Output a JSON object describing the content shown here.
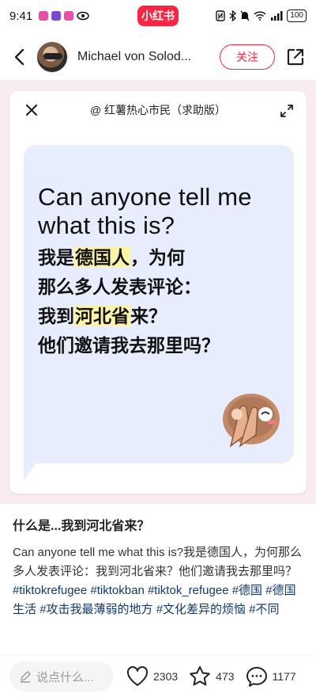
{
  "status_bar": {
    "time": "9:41",
    "app_pill": "小红书",
    "battery": "100",
    "notif_colors": [
      "#e94fa6",
      "#7b49d3",
      "#e94fa6"
    ]
  },
  "header": {
    "author_name": "Michael von Solod...",
    "follow_label": "关注"
  },
  "image_card": {
    "title": "@ 红薯热心市民（求助版）",
    "text_en": "Can anyone tell me what this is?",
    "text_zh_line1_a": "我是",
    "text_zh_line1_hl": "德国人",
    "text_zh_line1_b": "，为何",
    "text_zh_line2": "那么多人发表评论：",
    "text_zh_line3_a": "我到",
    "text_zh_line3_hl": "河北省",
    "text_zh_line3_b": "来？",
    "text_zh_line4": "他们邀请我去那里吗？",
    "emoji_icon": "face-with-hands-icon",
    "bubble_color": "#e7edfc",
    "highlight_color": "#fff3a8"
  },
  "post": {
    "title": "什么是...我到河北省来？",
    "body": "Can anyone tell me what this is?我是德国人，为何那么多人发表评论：我到河北省来？他们邀请我去那里吗？",
    "tags": [
      "#tiktokrefugee",
      "#tiktokban",
      "#tiktok_refugee",
      "#德国",
      "#德国生活",
      "#攻击我最薄弱的地方",
      "#文化差异的烦恼",
      "#不同"
    ]
  },
  "bottom_bar": {
    "comment_placeholder": "说点什么...",
    "likes": "2303",
    "collects": "473",
    "comments": "1177"
  },
  "colors": {
    "brand": "#ff2442",
    "tag": "#13386c",
    "image_bg": "#f9ecf0"
  }
}
